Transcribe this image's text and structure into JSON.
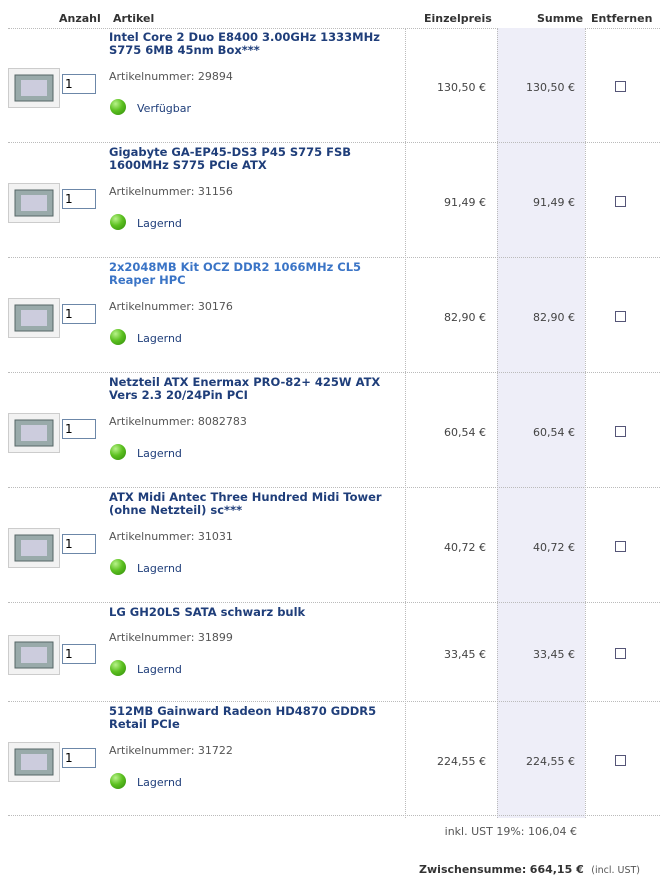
{
  "headers": {
    "anzahl": "Anzahl",
    "artikel": "Artikel",
    "einzelpreis": "Einzelpreis",
    "summe": "Summe",
    "entfernen": "Entfernen"
  },
  "items": [
    {
      "title": "Intel Core 2 Duo E8400 3.00GHz 1333MHz S775 6MB 45nm Box***",
      "artnr": "Artikelnummer: 29894",
      "status": "Verfügbar",
      "qty": "1",
      "price": "130,50 €",
      "sum": "130,50 €",
      "thumb": "cpu-box-thumbnail",
      "title_color": "#1f3e7a"
    },
    {
      "title": "Gigabyte GA-EP45-DS3 P45 S775 FSB 1600MHz S775 PCIe ATX",
      "artnr": "Artikelnummer: 31156",
      "status": "Lagernd",
      "qty": "1",
      "price": "91,49 €",
      "sum": "91,49 €",
      "thumb": "motherboard-thumbnail",
      "title_color": "#1f3e7a"
    },
    {
      "title": "2x2048MB Kit OCZ DDR2 1066MHz CL5 Reaper HPC",
      "artnr": "Artikelnummer: 30176",
      "status": "Lagernd",
      "qty": "1",
      "price": "82,90 €",
      "sum": "82,90 €",
      "thumb": "ram-thumbnail",
      "title_color": "#3a74c6"
    },
    {
      "title": "Netzteil ATX Enermax PRO-82+ 425W ATX Vers 2.3 20/24Pin PCI",
      "artnr": "Artikelnummer: 8082783",
      "status": "Lagernd",
      "qty": "1",
      "price": "60,54 €",
      "sum": "60,54 €",
      "thumb": "psu-thumbnail",
      "title_color": "#1f3e7a"
    },
    {
      "title": "ATX Midi Antec Three Hundred Midi Tower (ohne Netzteil) sc***",
      "artnr": "Artikelnummer: 31031",
      "status": "Lagernd",
      "qty": "1",
      "price": "40,72 €",
      "sum": "40,72 €",
      "thumb": "case-thumbnail",
      "title_color": "#1f3e7a"
    },
    {
      "title": "LG GH20LS SATA schwarz bulk",
      "artnr": "Artikelnummer: 31899",
      "status": "Lagernd",
      "qty": "1",
      "price": "33,45 €",
      "sum": "33,45 €",
      "thumb": "dvd-drive-thumbnail",
      "title_color": "#1f3e7a"
    },
    {
      "title": "512MB Gainward Radeon HD4870 GDDR5 Retail PCIe",
      "artnr": "Artikelnummer: 31722",
      "status": "Lagernd",
      "qty": "1",
      "price": "224,55 €",
      "sum": "224,55 €",
      "thumb": "graphics-card-thumbnail",
      "title_color": "#1f3e7a"
    }
  ],
  "totals": {
    "tax": "inkl. UST 19%: 106,04 €",
    "subtotal_label": "Zwischensumme:",
    "subtotal_value": "664,15 €",
    "subtotal_note": "(incl. UST)"
  }
}
